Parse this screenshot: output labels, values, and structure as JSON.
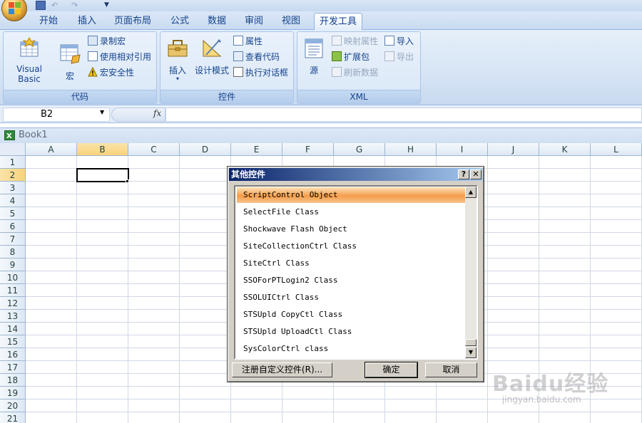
{
  "tabs": [
    "开始",
    "插入",
    "页面布局",
    "公式",
    "数据",
    "审阅",
    "视图",
    "开发工具"
  ],
  "active_tab": "开发工具",
  "ribbon": {
    "code": {
      "label": "代码",
      "visual_basic": "Visual Basic",
      "macros": "宏",
      "record_macro": "录制宏",
      "relative_refs": "使用相对引用",
      "macro_security": "宏安全性"
    },
    "controls": {
      "label": "控件",
      "insert": "插入",
      "design_mode": "设计模式",
      "properties": "属性",
      "view_code": "查看代码",
      "run_dialog": "执行对话框"
    },
    "xml": {
      "label": "XML",
      "source": "源",
      "map_properties": "映射属性",
      "expansion_packs": "扩展包",
      "refresh_data": "刷新数据",
      "import": "导入",
      "export": "导出"
    }
  },
  "formula_bar": {
    "name_box": "B2",
    "fx": "fx",
    "formula": ""
  },
  "workbook_title": "Book1",
  "columns": [
    "A",
    "B",
    "C",
    "D",
    "E",
    "F",
    "G",
    "H",
    "I",
    "J",
    "K",
    "L"
  ],
  "rows": [
    "1",
    "2",
    "3",
    "4",
    "5",
    "6",
    "7",
    "8",
    "9",
    "10",
    "11",
    "12",
    "13",
    "14",
    "15",
    "16",
    "17",
    "18",
    "19",
    "20",
    "21"
  ],
  "selected_cell": "B2",
  "dialog": {
    "title": "其他控件",
    "help": "?",
    "close": "✕",
    "items": [
      "ScriptControl Object",
      "SelectFile Class",
      "Shockwave Flash Object",
      "SiteCollectionCtrl Class",
      "SiteCtrl Class",
      "SSOForPTLogin2 Class",
      "SSOLUICtrl Class",
      "STSUpld CopyCtl Class",
      "STSUpld UploadCtl Class",
      "SysColorCtrl class"
    ],
    "selected_item": "ScriptControl Object",
    "register_button": "注册自定义控件(R)...",
    "ok_button": "确定",
    "cancel_button": "取消"
  },
  "watermark": {
    "text": "Baidu经验",
    "url": "jingyan.baidu.com"
  }
}
